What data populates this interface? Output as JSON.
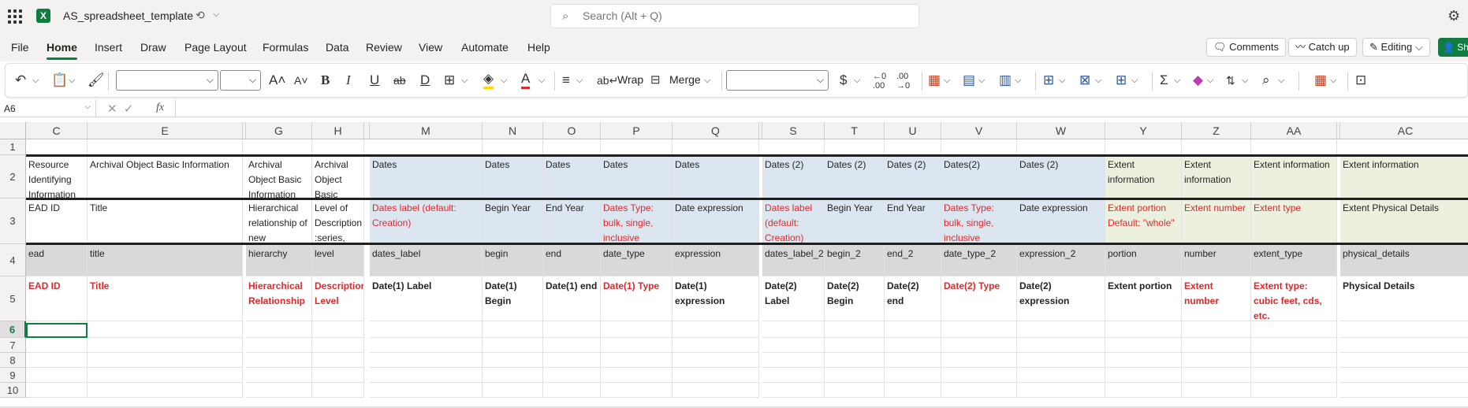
{
  "app": {
    "doc_title": "AS_spreadsheet_template",
    "search_placeholder": "Search (Alt + Q)"
  },
  "ribbon_tabs": [
    "File",
    "Home",
    "Insert",
    "Draw",
    "Page Layout",
    "Formulas",
    "Data",
    "Review",
    "View",
    "Automate",
    "Help"
  ],
  "ribbon_right": {
    "comments": "Comments",
    "catchup": "Catch up",
    "editing": "Editing",
    "share": "Sh"
  },
  "toolbar": {
    "wrap": "Wrap",
    "merge": "Merge",
    "font_name": "",
    "font_size": "",
    "number_format": ""
  },
  "name_box": "A6",
  "formula": "",
  "columns": [
    "C",
    "E",
    "",
    "G",
    "H",
    "",
    "M",
    "N",
    "O",
    "P",
    "Q",
    "",
    "S",
    "T",
    "U",
    "V",
    "W",
    "Y",
    "Z",
    "AA",
    "",
    "AC"
  ],
  "rows": [
    "1",
    "2",
    "3",
    "4",
    "5",
    "6",
    "7",
    "8",
    "9",
    "10"
  ],
  "row2": [
    "Resource Identifying Information",
    "Archival Object Basic Information",
    "Archival Object Basic Information",
    "Archival Object Basic",
    "Dates",
    "Dates",
    "Dates",
    "Dates",
    "Dates",
    "Dates (2)",
    "Dates (2)",
    "Dates (2)",
    "Dates(2)",
    "Dates (2)",
    "Extent information",
    "Extent information",
    "Extent information",
    "Extent information"
  ],
  "row3": [
    "EAD ID",
    "Title",
    "Hierarchical relationship of new",
    "Level of Description :series,",
    "Dates label (default: Creation)",
    "Begin Year",
    "End Year",
    "Dates Type: bulk, single, inclusive",
    "Date expression",
    "Dates label (default: Creation)",
    "Begin Year",
    "End Year",
    "Dates Type: bulk, single, inclusive",
    "Date expression",
    "Extent portion Default: \"whole\"",
    "Extent number",
    "Extent type",
    "Extent Physical Details"
  ],
  "row4": [
    "ead",
    "title",
    "hierarchy",
    "level",
    "dates_label",
    "begin",
    "end",
    "date_type",
    "expression",
    "dates_label_2",
    "begin_2",
    "end_2",
    "date_type_2",
    "expression_2",
    "portion",
    "number",
    "extent_type",
    "physical_details"
  ],
  "row5": [
    "EAD ID",
    "Title",
    "Hierarchical Relationship",
    "Description Level",
    "Date(1) Label",
    "Date(1) Begin",
    "Date(1) end",
    "Date(1) Type",
    "Date(1) expression",
    "Date(2) Label",
    "Date(2) Begin",
    "Date(2) end",
    "Date(2) Type",
    "Date(2) expression",
    "Extent portion",
    "Extent number",
    "Extent type: cubic feet, cds, etc.",
    "Physical Details"
  ],
  "colors": {
    "accent": "#107c41",
    "dates_fill": "#dce6f0",
    "extent_fill": "#ebf1de",
    "row4_fill": "#d9d9d9",
    "red_text": "#e0282a"
  }
}
